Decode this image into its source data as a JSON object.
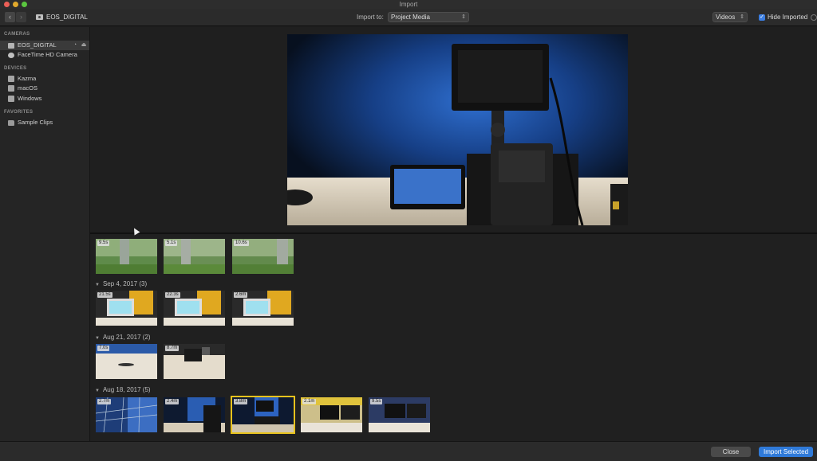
{
  "window": {
    "title": "Import"
  },
  "toolbar": {
    "source_name": "EOS_DIGITAL",
    "import_to_label": "Import to:",
    "import_to_value": "Project Media",
    "filter_value": "Videos",
    "hide_imported_label": "Hide Imported",
    "hide_imported_checked": true
  },
  "sidebar": {
    "sections": [
      {
        "title": "CAMERAS",
        "items": [
          {
            "label": "EOS_DIGITAL",
            "icon": "camera-icon",
            "selected": true
          },
          {
            "label": "FaceTime HD Camera",
            "icon": "webcam-icon",
            "selected": false
          }
        ]
      },
      {
        "title": "DEVICES",
        "items": [
          {
            "label": "Kazma",
            "icon": "drive-icon"
          },
          {
            "label": "macOS",
            "icon": "drive-icon"
          },
          {
            "label": "Windows",
            "icon": "drive-icon"
          }
        ]
      },
      {
        "title": "FAVORITES",
        "items": [
          {
            "label": "Sample Clips",
            "icon": "folder-icon"
          }
        ]
      }
    ]
  },
  "groups": [
    {
      "header": "",
      "clips": [
        {
          "duration": "9.5s",
          "scene": "park"
        },
        {
          "duration": "5.1s",
          "scene": "park"
        },
        {
          "duration": "10.6s",
          "scene": "park"
        }
      ]
    },
    {
      "header": "Sep 4, 2017  (3)",
      "clips": [
        {
          "duration": "21.5s",
          "scene": "monitor"
        },
        {
          "duration": "22.3s",
          "scene": "monitor"
        },
        {
          "duration": "2.6m",
          "scene": "monitor"
        }
      ]
    },
    {
      "header": "Aug 21, 2017  (2)",
      "clips": [
        {
          "duration": "7.0s",
          "scene": "desk"
        },
        {
          "duration": "8.7m",
          "scene": "hands"
        }
      ]
    },
    {
      "header": "Aug 18, 2017  (5)",
      "clips": [
        {
          "duration": "2.7m",
          "scene": "studio-grid"
        },
        {
          "duration": "2.4m",
          "scene": "studio-dark"
        },
        {
          "duration": "3.8m",
          "scene": "studio-blue",
          "selected": true
        },
        {
          "duration": "2.1m",
          "scene": "screens"
        },
        {
          "duration": "9.5s",
          "scene": "screens"
        }
      ]
    }
  ],
  "buttons": {
    "close": "Close",
    "import_selected": "Import Selected"
  },
  "colors": {
    "accent": "#2f7ad9",
    "selection": "#e7c21c"
  }
}
